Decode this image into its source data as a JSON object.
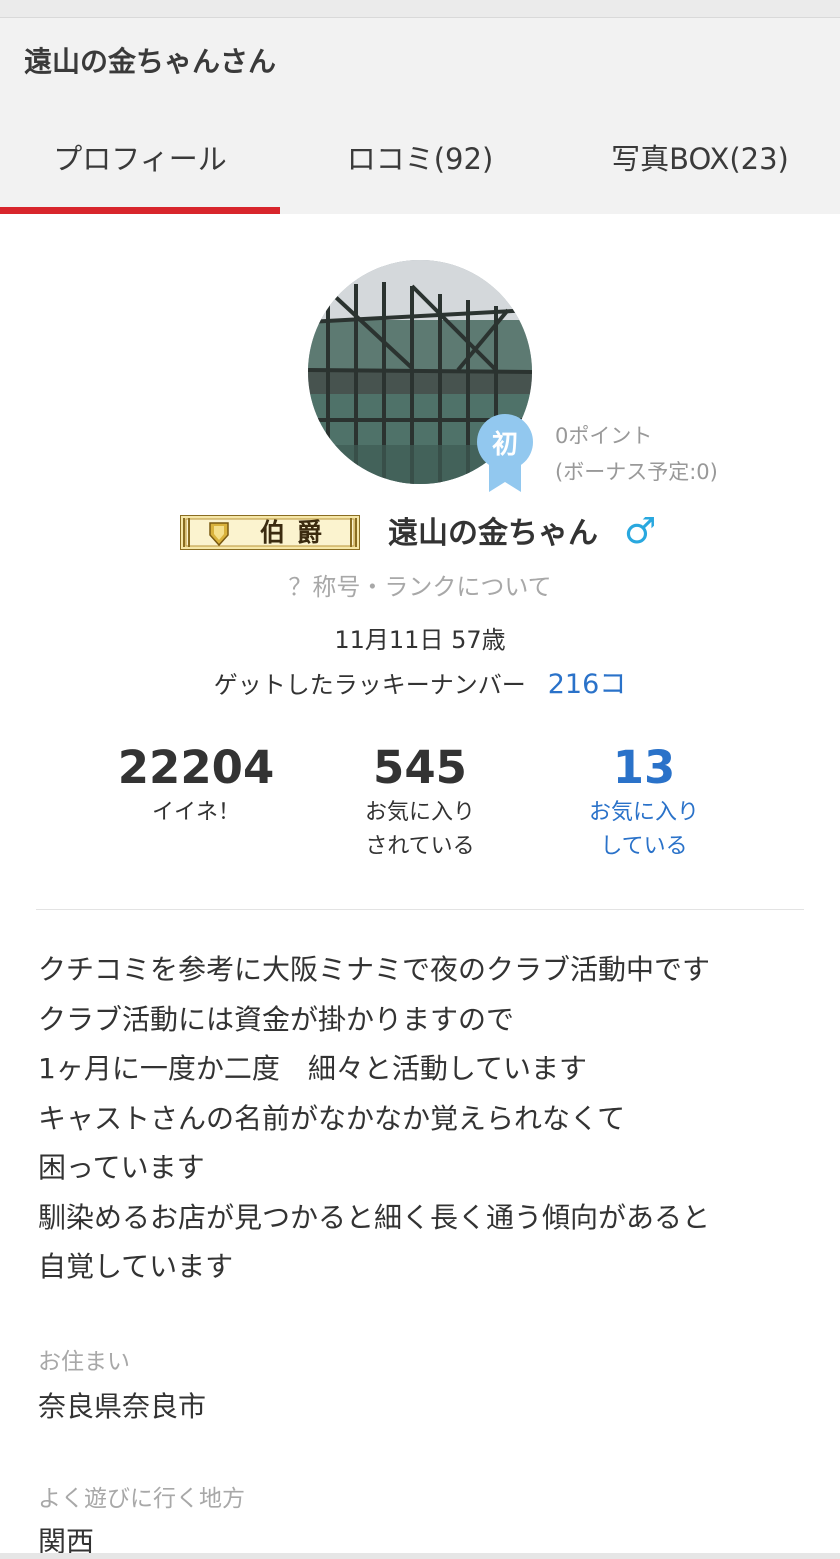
{
  "header": {
    "title": "遠山の金ちゃんさん",
    "tabs": [
      {
        "label": "プロフィール",
        "active": true
      },
      {
        "label": "ロコミ(92)",
        "active": false
      },
      {
        "label": "写真BOX(23)",
        "active": false
      }
    ],
    "accent_color": "#d8262c"
  },
  "profile": {
    "rank_badge_char": "初",
    "points": "0ポイント",
    "bonus": "(ボーナス予定:0)",
    "title_badge": "伯爵",
    "username": "遠山の金ちゃん",
    "gender_icon": "male-icon",
    "rank_link": "？称号・ランクについて",
    "birthday": "11月11日 57歳",
    "lucky_label": "ゲットしたラッキーナンバー",
    "lucky_count": "216コ",
    "link_color": "#2a72c9"
  },
  "stats": [
    {
      "value": "22204",
      "label_line1": "イイネ！",
      "label_line2": ""
    },
    {
      "value": "545",
      "label_line1": "お気に入り",
      "label_line2": "されている"
    },
    {
      "value": "13",
      "label_line1": "お気に入り",
      "label_line2": "している"
    }
  ],
  "bio": [
    "クチコミを参考に大阪ミナミで夜のクラブ活動中です",
    "クラブ活動には資金が掛かりますので",
    "1ヶ月に一度か二度　細々と活動しています",
    "キャストさんの名前がなかなか覚えられなくて",
    "困っています",
    "馴染めるお店が見つかると細く長く通う傾向があると",
    "自覚しています"
  ],
  "fields": {
    "residence_label": "お住まい",
    "residence_value": "奈良県奈良市",
    "area_label": "よく遊びに行く地方",
    "area_value": "関西"
  }
}
